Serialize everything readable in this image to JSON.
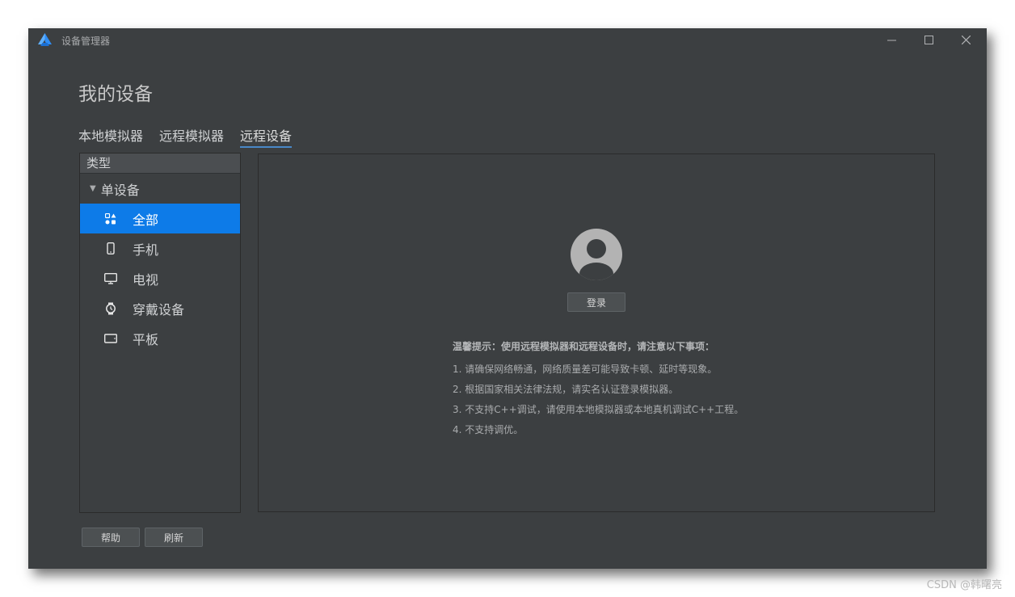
{
  "window": {
    "title": "设备管理器",
    "controls": {
      "minimize": "–",
      "maximize": "☐",
      "close": "✕"
    }
  },
  "page": {
    "title": "我的设备"
  },
  "tabs": [
    {
      "label": "本地模拟器",
      "active": false
    },
    {
      "label": "远程模拟器",
      "active": false
    },
    {
      "label": "远程设备",
      "active": true
    }
  ],
  "sidebar": {
    "header": "类型",
    "group": {
      "label": "单设备",
      "expanded": true
    },
    "items": [
      {
        "label": "全部",
        "icon": "all-devices-icon",
        "selected": true
      },
      {
        "label": "手机",
        "icon": "phone-icon",
        "selected": false
      },
      {
        "label": "电视",
        "icon": "tv-icon",
        "selected": false
      },
      {
        "label": "穿戴设备",
        "icon": "watch-icon",
        "selected": false
      },
      {
        "label": "平板",
        "icon": "tablet-icon",
        "selected": false
      }
    ]
  },
  "main": {
    "login_label": "登录",
    "tips_title": "温馨提示：使用远程模拟器和远程设备时，请注意以下事项：",
    "tips": [
      "1. 请确保网络畅通，网络质量差可能导致卡顿、延时等现象。",
      "2. 根据国家相关法律法规，请实名认证登录模拟器。",
      "3. 不支持C++调试，请使用本地模拟器或本地真机调试C++工程。",
      "4. 不支持调优。"
    ]
  },
  "footer": {
    "help_label": "帮助",
    "refresh_label": "刷新"
  },
  "watermark": "CSDN @韩曙亮",
  "colors": {
    "selected": "#0d7be8",
    "background": "#3c3f41",
    "tab_underline": "#4a88c7"
  }
}
